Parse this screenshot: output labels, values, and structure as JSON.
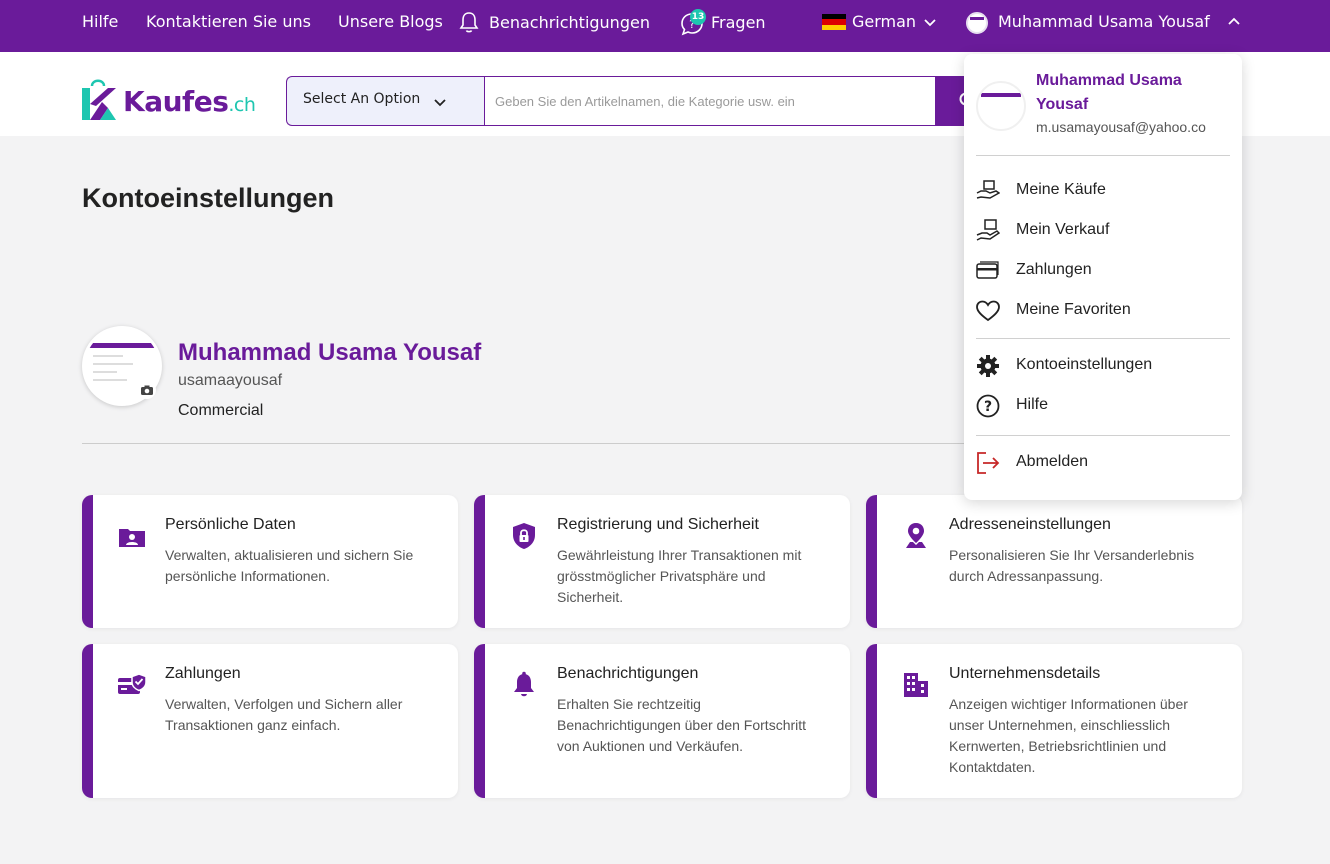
{
  "topbar": {
    "help": "Hilfe",
    "contact": "Kontaktieren Sie uns",
    "blogs": "Unsere Blogs",
    "notifications": "Benachrichtigungen",
    "questions": "Fragen",
    "questions_badge": "13",
    "language": "German",
    "user": "Muhammad Usama Yousaf"
  },
  "header": {
    "logo_main": "Kaufes",
    "logo_tld": ".ch",
    "select_label": "Select An Option",
    "search_placeholder": "Geben Sie den Artikelnamen, die Kategorie usw. ein"
  },
  "page": {
    "title": "Kontoeinstellungen",
    "profile": {
      "name": "Muhammad Usama Yousaf",
      "username": "usamaayousaf",
      "type": "Commercial"
    }
  },
  "cards": [
    {
      "title": "Persönliche Daten",
      "desc": "Verwalten, aktualisieren und sichern Sie persönliche Informationen.",
      "icon": "person-folder-icon"
    },
    {
      "title": "Registrierung und Sicherheit",
      "desc": "Gewährleistung Ihrer Transaktionen mit grösstmöglicher Privatsphäre und Sicherheit.",
      "icon": "shield-lock-icon"
    },
    {
      "title": "Adresseneinstellungen",
      "desc": "Personalisieren Sie Ihr Versanderlebnis durch Adressanpassung.",
      "icon": "location-pin-icon"
    },
    {
      "title": "Zahlungen",
      "desc": "Verwalten, Verfolgen und Sichern aller Transaktionen ganz einfach.",
      "icon": "card-shield-icon"
    },
    {
      "title": "Benachrichtigungen",
      "desc": "Erhalten Sie rechtzeitig Benachrichtigungen über den Fortschritt von Auktionen und Verkäufen.",
      "icon": "bell-icon"
    },
    {
      "title": "Unternehmensdetails",
      "desc": "Anzeigen wichtiger Informationen über unser Unternehmen, einschliesslich Kernwerten, Betriebsrichtlinien und Kontaktdaten.",
      "icon": "building-icon"
    }
  ],
  "dropdown": {
    "name": "Muhammad Usama Yousaf",
    "email": "m.usamayousaf@yahoo.co",
    "items": [
      {
        "label": "Meine Käufe",
        "icon": "hand-box-icon"
      },
      {
        "label": "Mein Verkauf",
        "icon": "hand-sell-icon"
      },
      {
        "label": "Zahlungen",
        "icon": "credit-card-icon"
      },
      {
        "label": "Meine Favoriten",
        "icon": "heart-icon"
      },
      {
        "label": "Kontoeinstellungen",
        "icon": "gear-icon"
      },
      {
        "label": "Hilfe",
        "icon": "help-circle-icon"
      },
      {
        "label": "Abmelden",
        "icon": "logout-icon"
      }
    ]
  },
  "colors": {
    "brand": "#6a1b9a",
    "accent": "#1ec6b0",
    "background": "#f3f3f4"
  }
}
